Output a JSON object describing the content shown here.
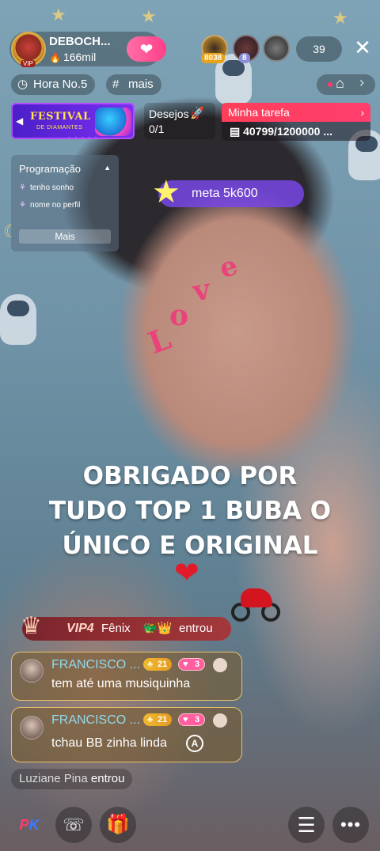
{
  "host": {
    "name": "DEBOCH...",
    "likes": "166mil",
    "avatar_badge": "VIP"
  },
  "top_viewers": [
    {
      "badge": "8038",
      "badge_color": "#e8a317"
    },
    {
      "badge": "8",
      "badge_color": "#8a8fd8"
    },
    {
      "badge": "",
      "badge_color": ""
    }
  ],
  "viewer_count": "39",
  "chips": {
    "hour_label": "Hora No.5",
    "more_label": "mais"
  },
  "festival": {
    "title": "FESTIVAL",
    "subtitle": "DE DIAMANTES"
  },
  "wishes": {
    "label": "Desejos",
    "value": "0/1"
  },
  "task": {
    "label": "Minha tarefa",
    "value": "40799/1200000 ..."
  },
  "schedule": {
    "title": "Programação",
    "items": [
      "tenho sonho",
      "nome no perfil"
    ],
    "more_label": "Mais"
  },
  "meta": {
    "text": "meta 5k600"
  },
  "face_text": "Love",
  "caption": {
    "line1": "OBRIGADO POR",
    "line2": "TUDO TOP 1 BUBA O",
    "line3": "ÚNICO E ORIGINAL",
    "heart": "❤"
  },
  "entry": {
    "vip": "VIP4",
    "name": "Fênix",
    "emoji": "🐲👑",
    "action": "entrou"
  },
  "messages": [
    {
      "name": "FRANCISCO ...",
      "level": "21",
      "hearts": "3",
      "text": "tem até uma musiquinha"
    },
    {
      "name": "FRANCISCO ...",
      "level": "21",
      "hearts": "3",
      "text": "tchau BB zinha linda",
      "icon": "A"
    }
  ],
  "joined": {
    "name": "Luziane Pina",
    "action": "entrou"
  },
  "bottom": {
    "pk_p": "P",
    "pk_k": "K"
  },
  "colors": {
    "accent_pink": "#ff3f88",
    "task_red": "#ff3e5a",
    "meta_purple": "#7846e6",
    "chat_name": "#8fdaf0"
  }
}
